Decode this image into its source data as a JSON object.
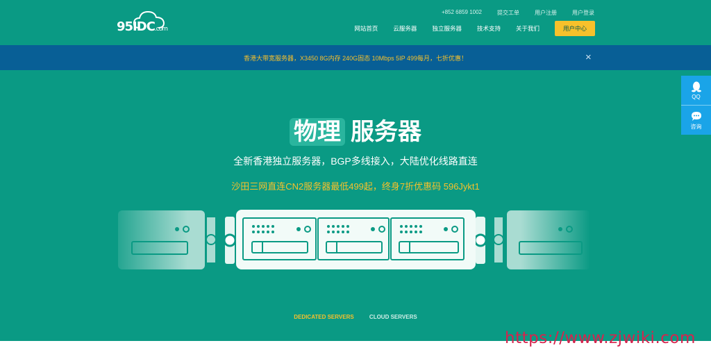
{
  "logo": {
    "text": "95IDC",
    "suffix": ".com"
  },
  "top_links": [
    "+852 6859 1002",
    "提交工单",
    "用户注册",
    "用户登录"
  ],
  "nav": {
    "items": [
      "网站首页",
      "云服务器",
      "独立服务器",
      "技术支持",
      "关于我们"
    ],
    "cta": "用户中心"
  },
  "banner": {
    "text": "香港大带宽服务器，X3450 8G内存 240G固态 10Mbps 5IP 499每月，七折优惠！",
    "close": "×"
  },
  "hero": {
    "badge": "物理",
    "title": "服务器",
    "subtitle": "全新香港独立服务器，BGP多线接入，大陆优化线路直连",
    "promo": "沙田三网直连CN2服务器最低499起，终身7折优惠码 596Jykt1"
  },
  "tabs": {
    "active": "DEDICATED SERVERS",
    "inactive": "CLOUD SERVERS"
  },
  "sidebar": {
    "qq": "QQ",
    "consult": "咨询"
  },
  "watermark": "https://www.zjwiki.com",
  "colors": {
    "bg": "#0a9a84",
    "banner": "#085f96",
    "accent": "#f7c12b",
    "side": "#1aa4e8"
  }
}
